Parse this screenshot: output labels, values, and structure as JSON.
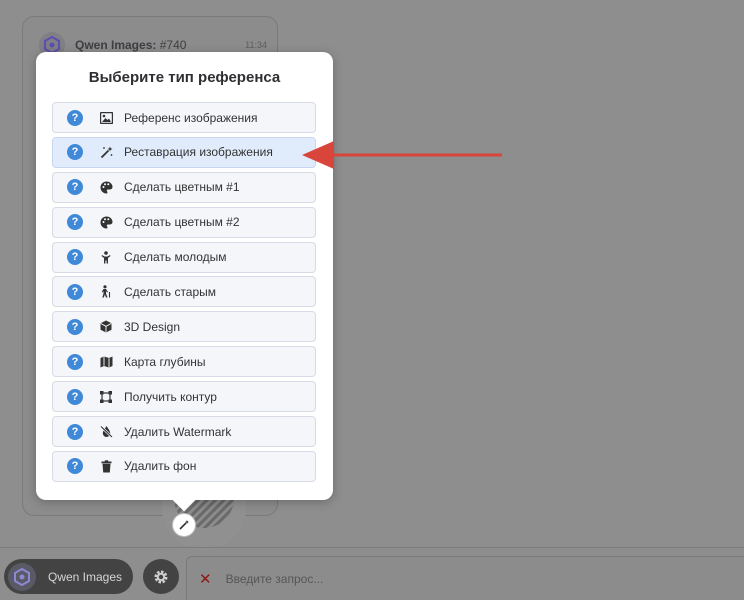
{
  "chat": {
    "bot_name": "Qwen Images",
    "msg_number": "#740",
    "time": "11:34"
  },
  "dialog": {
    "title": "Выберите тип референса",
    "options": [
      {
        "label": "Референс изображения",
        "icon": "image-icon"
      },
      {
        "label": "Реставрация изображения",
        "icon": "magic-wand-icon"
      },
      {
        "label": "Сделать цветным #1",
        "icon": "palette-icon"
      },
      {
        "label": "Сделать цветным #2",
        "icon": "palette-icon"
      },
      {
        "label": "Сделать молодым",
        "icon": "child-icon"
      },
      {
        "label": "Сделать старым",
        "icon": "elderly-person-icon"
      },
      {
        "label": "3D Design",
        "icon": "cube-icon"
      },
      {
        "label": "Карта глубины",
        "icon": "map-icon"
      },
      {
        "label": "Получить контур",
        "icon": "vector-square-icon"
      },
      {
        "label": "Удалить Watermark",
        "icon": "droplet-slash-icon"
      },
      {
        "label": "Удалить фон",
        "icon": "trash-icon"
      }
    ],
    "help_glyph": "?"
  },
  "bottom": {
    "model_label": "Qwen Images",
    "prompt_placeholder": "Введите запрос...",
    "clear_glyph": "✕"
  },
  "colors": {
    "accent": "#3f89d8",
    "highlight_row": "#e0ecfb",
    "arrow": "#d9443b",
    "overlay": "#8e8e8e"
  }
}
